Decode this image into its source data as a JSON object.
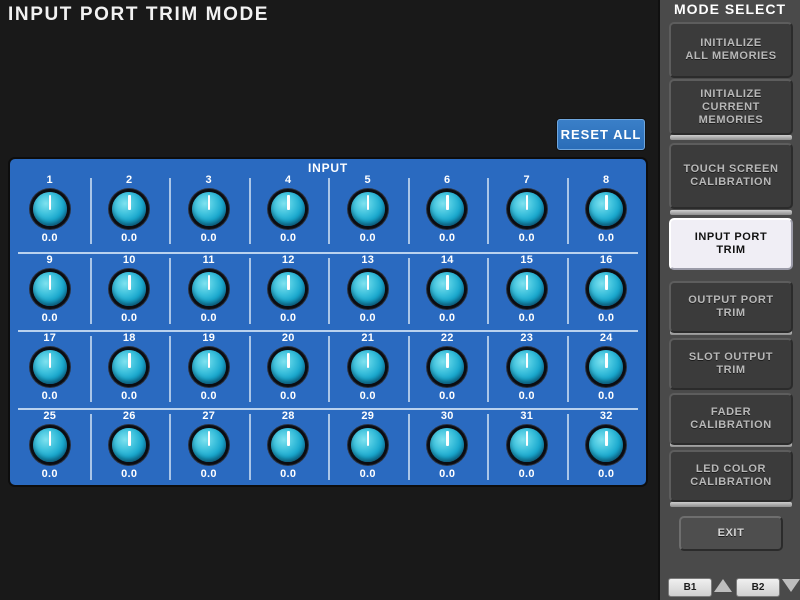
{
  "page_title": "INPUT PORT TRIM MODE",
  "background_color": "#191919",
  "reset_button": {
    "label": "RESET ALL",
    "color": "#2f73be"
  },
  "input_panel": {
    "label": "INPUT",
    "panel_color": "#2a6ac0",
    "selected_channel": 1,
    "selection_ring_color": "#b84fb0",
    "knob_color": "#1fb0d2",
    "channels": [
      {
        "num": "1",
        "value": "0.0"
      },
      {
        "num": "2",
        "value": "0.0"
      },
      {
        "num": "3",
        "value": "0.0"
      },
      {
        "num": "4",
        "value": "0.0"
      },
      {
        "num": "5",
        "value": "0.0"
      },
      {
        "num": "6",
        "value": "0.0"
      },
      {
        "num": "7",
        "value": "0.0"
      },
      {
        "num": "8",
        "value": "0.0"
      },
      {
        "num": "9",
        "value": "0.0"
      },
      {
        "num": "10",
        "value": "0.0"
      },
      {
        "num": "11",
        "value": "0.0"
      },
      {
        "num": "12",
        "value": "0.0"
      },
      {
        "num": "13",
        "value": "0.0"
      },
      {
        "num": "14",
        "value": "0.0"
      },
      {
        "num": "15",
        "value": "0.0"
      },
      {
        "num": "16",
        "value": "0.0"
      },
      {
        "num": "17",
        "value": "0.0"
      },
      {
        "num": "18",
        "value": "0.0"
      },
      {
        "num": "19",
        "value": "0.0"
      },
      {
        "num": "20",
        "value": "0.0"
      },
      {
        "num": "21",
        "value": "0.0"
      },
      {
        "num": "22",
        "value": "0.0"
      },
      {
        "num": "23",
        "value": "0.0"
      },
      {
        "num": "24",
        "value": "0.0"
      },
      {
        "num": "25",
        "value": "0.0"
      },
      {
        "num": "26",
        "value": "0.0"
      },
      {
        "num": "27",
        "value": "0.0"
      },
      {
        "num": "28",
        "value": "0.0"
      },
      {
        "num": "29",
        "value": "0.0"
      },
      {
        "num": "30",
        "value": "0.0"
      },
      {
        "num": "31",
        "value": "0.0"
      },
      {
        "num": "32",
        "value": "0.0"
      }
    ]
  },
  "mode_select": {
    "title": "MODE SELECT",
    "active_index": 3,
    "buttons": [
      {
        "line1": "INITIALIZE",
        "line2": "ALL MEMORIES"
      },
      {
        "line1": "INITIALIZE",
        "line2": "CURRENT MEMORIES"
      },
      {
        "line1": "TOUCH SCREEN",
        "line2": "CALIBRATION"
      },
      {
        "line1": "INPUT PORT",
        "line2": "TRIM"
      },
      {
        "line1": "OUTPUT PORT",
        "line2": "TRIM"
      },
      {
        "line1": "SLOT OUTPUT",
        "line2": "TRIM"
      },
      {
        "line1": "FADER",
        "line2": "CALIBRATION"
      },
      {
        "line1": "LED COLOR",
        "line2": "CALIBRATION"
      }
    ],
    "exit_label": "EXIT"
  },
  "bank_bar": {
    "bank1_label": "B1",
    "bank2_label": "B2",
    "up_icon": "triangle-up-icon",
    "down_icon": "triangle-down-icon"
  }
}
